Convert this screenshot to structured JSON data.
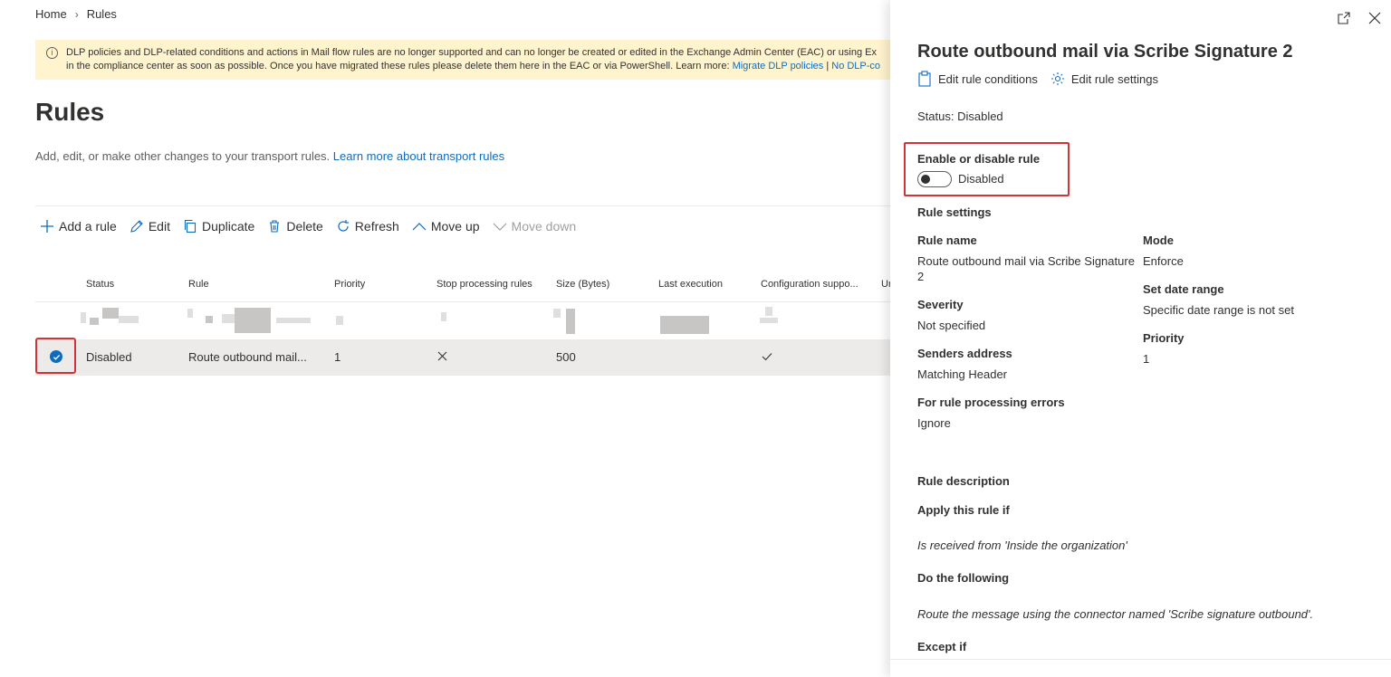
{
  "breadcrumb": {
    "home": "Home",
    "current": "Rules"
  },
  "banner": {
    "line1": "DLP policies and DLP-related conditions and actions in Mail flow rules are no longer supported and can no longer be created or edited in the Exchange Admin Center (EAC) or using Ex",
    "line2": "in the compliance center as soon as possible. Once you have migrated these rules please delete them here in the EAC or via PowerShell. Learn more: ",
    "link1": "Migrate DLP policies",
    "sep": " |  ",
    "link2": "No DLP-co"
  },
  "page": {
    "title": "Rules",
    "desc": "Add, edit, or make other changes to your transport rules. ",
    "desc_link": "Learn more about transport rules"
  },
  "toolbar": {
    "add": "Add a rule",
    "edit": "Edit",
    "duplicate": "Duplicate",
    "delete": "Delete",
    "refresh": "Refresh",
    "move_up": "Move up",
    "move_down": "Move down"
  },
  "table": {
    "headers": [
      "Status",
      "Rule",
      "Priority",
      "Stop processing rules",
      "Size (Bytes)",
      "Last execution",
      "Configuration suppo...",
      "Ur"
    ],
    "selected_row": {
      "status": "Disabled",
      "rule": "Route outbound mail...",
      "priority": "1",
      "size": "500"
    }
  },
  "panel": {
    "title": "Route outbound mail via Scribe Signature 2",
    "edit_conditions": "Edit rule conditions",
    "edit_settings": "Edit rule settings",
    "status": "Status: Disabled",
    "toggle_title": "Enable or disable rule",
    "toggle_label": "Disabled",
    "rule_settings": "Rule settings",
    "rule_name_label": "Rule name",
    "rule_name_value_1": "Route outbound mail via Scribe Signature",
    "rule_name_value_2": "2",
    "mode_label": "Mode",
    "mode_value": "Enforce",
    "severity_label": "Severity",
    "severity_value": "Not specified",
    "date_range_label": "Set date range",
    "date_range_value": "Specific date range is not set",
    "senders_label": "Senders address",
    "senders_value": "Matching Header",
    "priority_label": "Priority",
    "priority_value": "1",
    "errors_label": "For rule processing errors",
    "errors_value": "Ignore",
    "rule_description": "Rule description",
    "apply_if": "Apply this rule if",
    "apply_if_value": "Is received from 'Inside the organization'",
    "do_following": "Do the following",
    "do_following_value": "Route the message using the connector named 'Scribe signature outbound'.",
    "except_if": "Except if"
  },
  "colors": {
    "accent": "#0f6cbd",
    "highlight": "#d13438",
    "banner_bg": "#fff4ce"
  }
}
